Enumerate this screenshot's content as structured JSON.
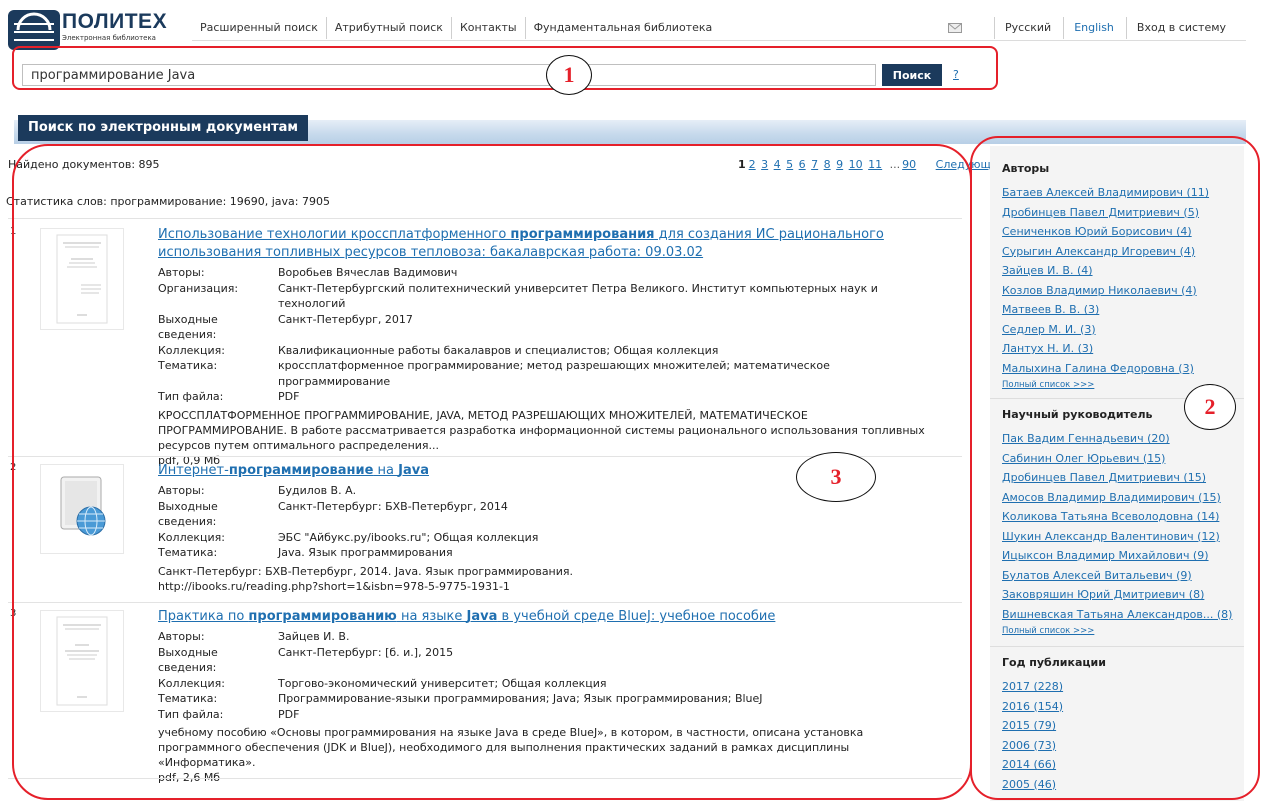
{
  "logo": {
    "title": "ПОЛИТЕХ",
    "subtitle": "Электронная библиотека"
  },
  "nav": [
    {
      "label": "Расширенный поиск"
    },
    {
      "label": "Атрибутный поиск"
    },
    {
      "label": "Контакты"
    },
    {
      "label": "Фундаментальная библиотека"
    }
  ],
  "lang": {
    "ru": "Русский",
    "en": "English",
    "login": "Вход в систему"
  },
  "search": {
    "value": "программирование Java",
    "button": "Поиск",
    "help": "?"
  },
  "section": {
    "title": "Поиск по электронным документам"
  },
  "results": {
    "found": "Найдено документов: 895",
    "pager": {
      "current": "1",
      "pages": [
        "2",
        "3",
        "4",
        "5",
        "6",
        "7",
        "8",
        "9",
        "10",
        "11"
      ],
      "ellipsis": "...",
      "last": "90",
      "next": "Следующая"
    },
    "stats": "Статистика слов: программирование: 19690, java: 7905",
    "items": [
      {
        "num": "1",
        "title": "Использование технологии кроссплатформенного программирования для создания ИС рационального использования топливных ресурсов тепловоза: бакалаврская работа: 09.03.02",
        "title_parts": [
          "Использование технологии кроссплатформенного ",
          "программирования",
          " для создания ИС рационального использования топливных ресурсов тепловоза: бакалаврская работа: 09.03.02"
        ],
        "meta": [
          {
            "label": "Авторы:",
            "value": "Воробьев Вячеслав Вадимович"
          },
          {
            "label": "Организация:",
            "value": "Санкт-Петербургский политехнический университет Петра Великого. Институт компьютерных наук и технологий"
          },
          {
            "label": "Выходные сведения:",
            "value": "Санкт-Петербург, 2017"
          },
          {
            "label": "Коллекция:",
            "value": "Квалификационные работы бакалавров и специалистов; Общая коллекция"
          },
          {
            "label": "Тематика:",
            "value": "кроссплатформенное программирование; метод разрешающих множителей; математическое программирование"
          },
          {
            "label": "Тип файла:",
            "value": "PDF"
          }
        ],
        "description": "КРОССПЛАТФОРМЕННОЕ ПРОГРАММИРОВАНИЕ, JAVA, МЕТОД РАЗРЕШАЮЩИХ МНОЖИТЕЛЕЙ, МАТЕМАТИЧЕСКОЕ ПРОГРАММИРОВАНИЕ. В работе рассматривается разработка информационной системы рационального использования топливных ресурсов путем оптимального распределения...",
        "size": "pdf, 0,9 Мб"
      },
      {
        "num": "2",
        "title": "Интернет-программирование на Java",
        "title_parts": [
          "Интернет-",
          "программирование",
          " на ",
          "Java"
        ],
        "meta": [
          {
            "label": "Авторы:",
            "value": "Будилов В. А."
          },
          {
            "label": "Выходные сведения:",
            "value": "Санкт-Петербург: БХВ-Петербург, 2014"
          },
          {
            "label": "Коллекция:",
            "value": "ЭБС \"Айбукс.ру/ibooks.ru\"; Общая коллекция"
          },
          {
            "label": "Тематика:",
            "value": "Java. Язык программирования"
          }
        ],
        "description": "Санкт-Петербург: БХВ-Петербург, 2014. Java. Язык программирования.",
        "size": "http://ibooks.ru/reading.php?short=1&isbn=978-5-9775-1931-1"
      },
      {
        "num": "3",
        "title": "Практика по программированию на языке Java в учебной среде BlueJ: учебное пособие",
        "title_parts": [
          "Практика по ",
          "программированию",
          " на языке ",
          "Java",
          " в учебной среде BlueJ: учебное пособие"
        ],
        "meta": [
          {
            "label": "Авторы:",
            "value": "Зайцев И. В."
          },
          {
            "label": "Выходные сведения:",
            "value": "Санкт-Петербург: [б. и.], 2015"
          },
          {
            "label": "Коллекция:",
            "value": "Торгово-экономический университет; Общая коллекция"
          },
          {
            "label": "Тематика:",
            "value": "Программирование-языки программирования; Java; Язык программирования; BlueJ"
          },
          {
            "label": "Тип файла:",
            "value": "PDF"
          }
        ],
        "description": "учебному пособию «Основы программирования на языке Java в среде BlueJ», в котором, в частности, описана установка программного обеспечения (JDK и BlueJ), необходимого для выполнения практических заданий в рамках дисциплины «Информатика».",
        "size": "pdf, 2,6 Мб"
      }
    ]
  },
  "facets": {
    "authors": {
      "title": "Авторы",
      "items": [
        "Батаев Алексей Владимирович (11)",
        "Дробинцев Павел Дмитриевич (5)",
        "Сениченков Юрий Борисович (4)",
        "Сурыгин Александр Игоревич (4)",
        "Зайцев И. В. (4)",
        "Козлов Владимир Николаевич (4)",
        "Матвеев В. В. (3)",
        "Седлер М. И. (3)",
        "Лантух Н. И. (3)",
        "Малыхина Галина Федоровна (3)"
      ],
      "more": "Полный список >>>"
    },
    "supervisor": {
      "title": "Научный руководитель",
      "items": [
        "Пак Вадим Геннадьевич (20)",
        "Сабинин Олег Юрьевич (15)",
        "Дробинцев Павел Дмитриевич (15)",
        "Амосов Владимир Владимирович (15)",
        "Коликова Татьяна Всеволодовна (14)",
        "Шукин Александр Валентинович (12)",
        "Ицыксон Владимир Михайлович (9)",
        "Булатов Алексей Витальевич (9)",
        "Заковряшин Юрий Дмитриевич (8)",
        "Вишневская Татьяна Александров... (8)"
      ],
      "more": "Полный список >>>"
    },
    "year": {
      "title": "Год публикации",
      "items": [
        "2017 (228)",
        "2016 (154)",
        "2015 (79)",
        "2006 (73)",
        "2014 (66)",
        "2005 (46)"
      ]
    }
  },
  "annotations": {
    "a1": "1",
    "a2": "2",
    "a3": "3"
  },
  "colors": {
    "brand": "#1b3a5c",
    "link": "#1f6fb0",
    "annotation": "#e5202a"
  }
}
